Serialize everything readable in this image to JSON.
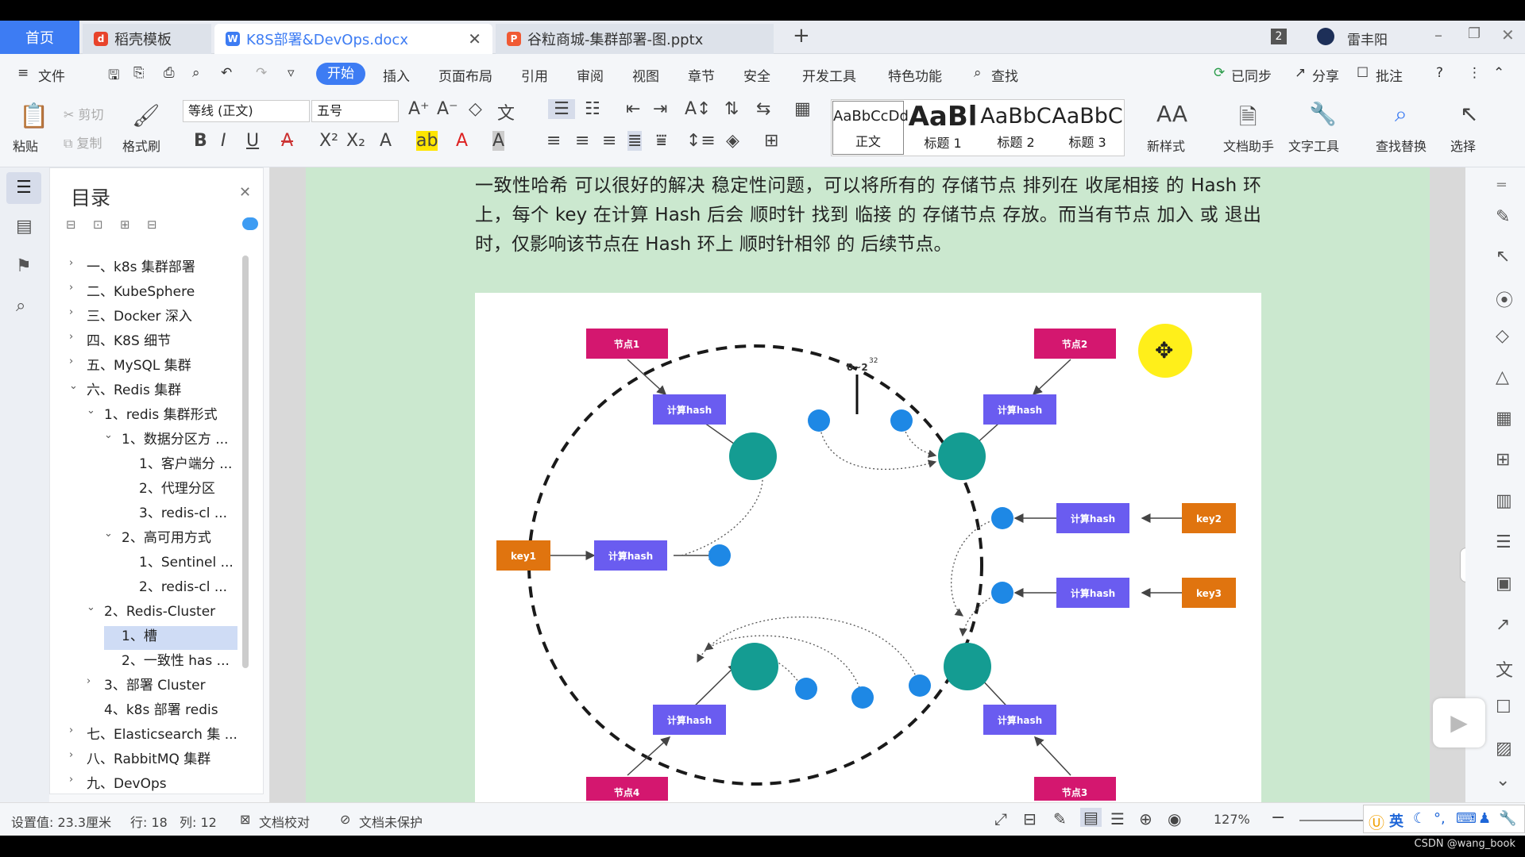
{
  "tabs": {
    "home": "首页",
    "daoke": "稻壳模板",
    "doc": "K8S部署&DevOps.docx",
    "ppt": "谷粒商城-集群部署-图.pptx",
    "add": "+",
    "count": "2",
    "user": "雷丰阳"
  },
  "menu": {
    "file": "文件",
    "items": [
      "开始",
      "插入",
      "页面布局",
      "引用",
      "审阅",
      "视图",
      "章节",
      "安全",
      "开发工具",
      "特色功能"
    ],
    "search": "查找",
    "sync": "已同步",
    "share": "分享",
    "comment": "批注"
  },
  "ribbon": {
    "paste": "粘贴",
    "cut": "剪切",
    "copy": "复制",
    "format_painter": "格式刷",
    "font": "等线 (正文)",
    "size": "五号",
    "styles": [
      {
        "preview": "AaBbCcDd",
        "label": "正文"
      },
      {
        "preview": "AaBl",
        "label": "标题 1"
      },
      {
        "preview": "AaBbC",
        "label": "标题 2"
      },
      {
        "preview": "AaBbC",
        "label": "标题 3"
      }
    ],
    "new_style": "新样式",
    "doc_helper": "文档助手",
    "text_tool": "文字工具",
    "find_replace": "查找替换",
    "select": "选择"
  },
  "toc": {
    "title": "目录",
    "items": [
      {
        "text": "一、k8s 集群部署",
        "chev": "›"
      },
      {
        "text": "二、KubeSphere",
        "chev": "›"
      },
      {
        "text": "三、Docker 深入",
        "chev": "›"
      },
      {
        "text": "四、K8S 细节",
        "chev": "›"
      },
      {
        "text": "五、MySQL 集群",
        "chev": "›"
      },
      {
        "text": "六、Redis 集群",
        "chev": "⌄"
      },
      {
        "text": "1、redis 集群形式",
        "chev": "⌄"
      },
      {
        "text": "1、数据分区方 ...",
        "chev": "⌄"
      },
      {
        "text": "1、客户端分 ...",
        "chev": ""
      },
      {
        "text": "2、代理分区",
        "chev": ""
      },
      {
        "text": "3、redis-cl ...",
        "chev": ""
      },
      {
        "text": "2、高可用方式",
        "chev": "⌄"
      },
      {
        "text": "1、Sentinel ...",
        "chev": ""
      },
      {
        "text": "2、redis-cl ...",
        "chev": ""
      },
      {
        "text": "2、Redis-Cluster",
        "chev": "⌄"
      },
      {
        "text": "1、槽",
        "chev": ""
      },
      {
        "text": "2、一致性 has ...",
        "chev": ""
      },
      {
        "text": "3、部署 Cluster",
        "chev": "›"
      },
      {
        "text": "4、k8s 部署 redis",
        "chev": ""
      },
      {
        "text": "七、Elasticsearch 集 ...",
        "chev": "›"
      },
      {
        "text": "八、RabbitMQ 集群",
        "chev": "›"
      },
      {
        "text": "九、DevOps",
        "chev": "›"
      }
    ]
  },
  "paragraph": "一致性哈希 可以很好的解决 稳定性问题，可以将所有的 存储节点 排列在 收尾相接 的 Hash 环上，每个 key 在计算 Hash 后会 顺时针 找到 临接 的 存储节点 存放。而当有节点 加入 或 退出 时，仅影响该节点在 Hash 环上 顺时针相邻 的 后续节点。",
  "diagram": {
    "node1": "节点1",
    "node2": "节点2",
    "node3": "节点3",
    "node4": "节点4",
    "hash": "计算hash",
    "key1": "key1",
    "key2": "key2",
    "key3": "key3",
    "ring_label": "0~2",
    "ring_exp": "32"
  },
  "status": {
    "setting": "设置值: 23.3厘米",
    "row": "行: 18",
    "col": "列: 12",
    "proof": "文档校对",
    "protect": "文档未保护",
    "zoom": "127%"
  },
  "ime": "英",
  "watermark": "CSDN @wang_book",
  "colors": {
    "accent": "#3d7cf3",
    "page_bg": "#cbe8cf",
    "node": "#d4176f",
    "hash_box": "#6a5cf0",
    "key_box": "#e0740f",
    "ring_node": "#149c92",
    "ring_dot": "#1e88e5"
  }
}
